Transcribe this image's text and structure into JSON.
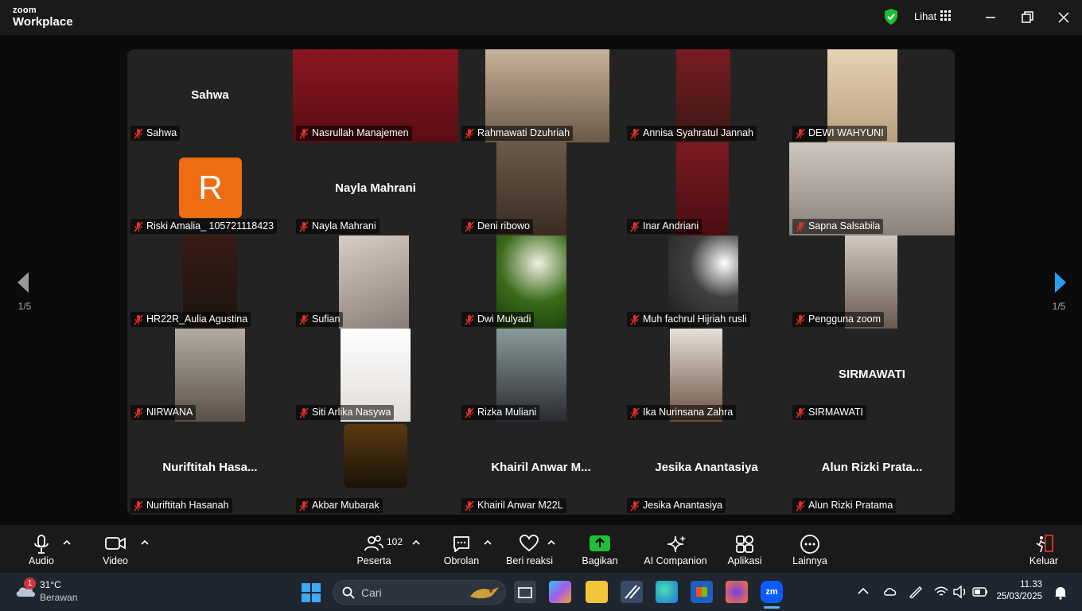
{
  "app": {
    "logo_line1": "zoom",
    "logo_line2": "Workplace",
    "view_label": "Lihat"
  },
  "gallery": {
    "page_indicator_left": "1/5",
    "page_indicator_right": "1/5",
    "tiles": [
      {
        "name": "Sahwa",
        "big": "Sahwa",
        "video": false
      },
      {
        "name": "Nasrullah Manajemen",
        "video": true,
        "active": true
      },
      {
        "name": "Rahmawati Dzuhriah",
        "video": true
      },
      {
        "name": "Annisa Syahratul Jannah",
        "video": true
      },
      {
        "name": "DEWI WAHYUNI",
        "video": true
      },
      {
        "name": "Riski Amalia_ 105721118423",
        "avatar": "R",
        "video": false
      },
      {
        "name": "Nayla Mahrani",
        "big": "Nayla Mahrani",
        "video": false
      },
      {
        "name": "Deni ribowo",
        "video": true
      },
      {
        "name": "Inar Andriani",
        "video": true
      },
      {
        "name": "Sapna Salsabila",
        "video": true
      },
      {
        "name": "HR22R_Aulia Agustina",
        "video": true
      },
      {
        "name": "Sufian",
        "video": true
      },
      {
        "name": "Dwi Mulyadi",
        "video": true
      },
      {
        "name": "Muh fachrul Hijriah rusli",
        "video": true
      },
      {
        "name": "Pengguna zoom",
        "video": true
      },
      {
        "name": "NIRWANA",
        "video": true
      },
      {
        "name": "Siti Arlika Nasywa",
        "video": true
      },
      {
        "name": "Rizka Muliani",
        "video": true
      },
      {
        "name": "Ika Nurinsana Zahra",
        "video": true
      },
      {
        "name": "SIRMAWATI",
        "big": "SIRMAWATI",
        "video": false
      },
      {
        "name": "Nuriftitah Hasanah",
        "big": "Nuriftitah  Hasa...",
        "video": false
      },
      {
        "name": "Akbar Mubarak",
        "video": true
      },
      {
        "name": "Khairil Anwar M22L",
        "big": "Khairil Anwar M...",
        "video": false
      },
      {
        "name": "Jesika Anantasiya",
        "big": "Jesika Anantasiya",
        "video": false
      },
      {
        "name": "Alun Rizki Pratama",
        "big": "Alun Rizki Prata...",
        "video": false
      }
    ]
  },
  "toolbar": {
    "audio": "Audio",
    "video": "Video",
    "participants": "Peserta",
    "participant_count": "102",
    "chat": "Obrolan",
    "react": "Beri reaksi",
    "share": "Bagikan",
    "ai": "AI Companion",
    "apps": "Aplikasi",
    "more": "Lainnya",
    "leave": "Keluar",
    "share_color": "#1fbf3a"
  },
  "taskbar": {
    "weather_temp": "31°C",
    "weather_desc": "Berawan",
    "weather_badge": "1",
    "search_placeholder": "Cari",
    "time": "11.33",
    "date": "25/03/2025"
  }
}
